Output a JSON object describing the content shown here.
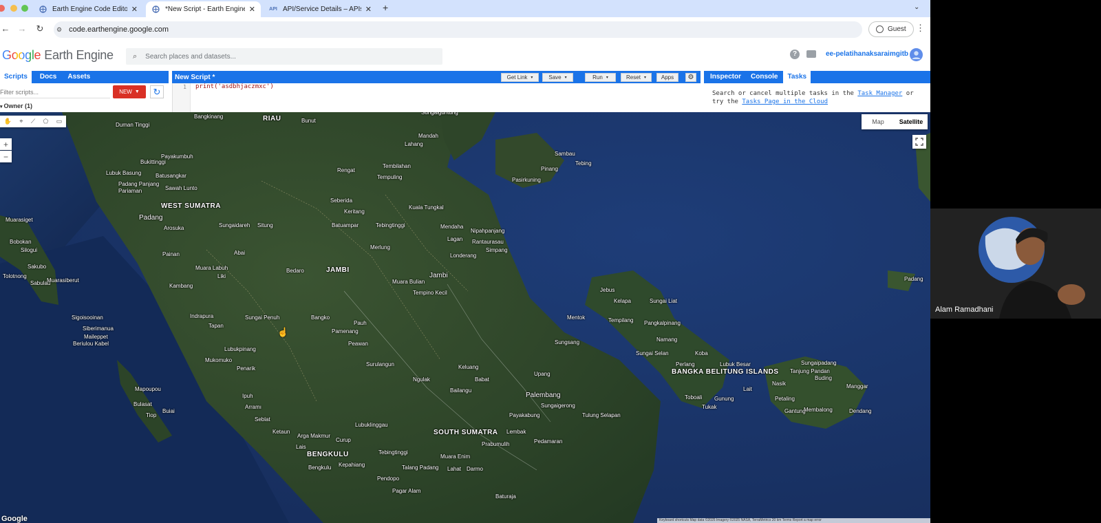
{
  "browser": {
    "tabs": [
      {
        "title": "Earth Engine Code Editor",
        "active": false
      },
      {
        "title": "*New Script - Earth Engine Co",
        "active": true
      },
      {
        "title": "API/Service Details – APIs & S",
        "active": false
      }
    ],
    "api_badge": "API",
    "new_tab": "+",
    "url": "code.earthengine.google.com",
    "guest_label": "Guest"
  },
  "ee": {
    "logo_google": "Google",
    "logo_product": "Earth Engine",
    "search_placeholder": "Search places and datasets...",
    "project": "ee-pelatihanaksaraimgitb"
  },
  "left_panel": {
    "tabs": [
      "Scripts",
      "Docs",
      "Assets"
    ],
    "filter_placeholder": "Filter scripts...",
    "new_button": "NEW",
    "owner_label": "Owner (1)"
  },
  "editor": {
    "title": "New Script *",
    "buttons": [
      "Get Link",
      "Save",
      "Run",
      "Reset",
      "Apps"
    ],
    "line_number": "1",
    "code": "print('asdbhjaczmxc')"
  },
  "right_panel": {
    "tabs": [
      "Inspector",
      "Console",
      "Tasks"
    ],
    "text_1": "Search or cancel multiple tasks in the ",
    "link_1": "Task Manager",
    "text_2": " or try the ",
    "link_2": "Tasks Page in the Cloud"
  },
  "map": {
    "type_buttons": [
      "Map",
      "Satellite"
    ],
    "active_type": "Satellite",
    "zoom_in": "+",
    "zoom_out": "−",
    "google_watermark": "Google",
    "attribution": "Keyboard shortcuts   Map data ©2025 Imagery ©2025 NASA, TerraMetrics   20 km   Terms   Report a map error",
    "labels": [
      "RIAU",
      "Duman Tinggi",
      "Bangkinang",
      "Bunut",
      "Mandah",
      "Sungaiguntung",
      "Lahang",
      "Payakumbuh",
      "Bukittinggi",
      "Lubuk Basung",
      "Batusangkar",
      "Padang Panjang",
      "Pariaman",
      "Sawah Lunto",
      "Rengat",
      "Tembilahan",
      "Tempuling",
      "Sambau",
      "Tebing",
      "Pinang",
      "Pasirkuning",
      "WEST SUMATRA",
      "Padang",
      "Arosuka",
      "Seberida",
      "Keritang",
      "Kuala Tungkal",
      "Muarasiget",
      "Sungaidareh",
      "Situng",
      "Batuampar",
      "Tebingtinggi",
      "Mendaha",
      "Nipahpanjang",
      "Rantaurasau",
      "Bobokan",
      "Silogui",
      "Sakubo",
      "Tolotnong",
      "Sabulau",
      "Muarasiberut",
      "Painan",
      "Abai",
      "Lagan",
      "Merlung",
      "Londerang",
      "Simpang",
      "Muara Labuh",
      "Liki",
      "Kambang",
      "JAMBI",
      "Bedaro",
      "Muara Bulian",
      "Jambi",
      "Tempino Kecil",
      "Jebus",
      "Kelapa",
      "Sungai Liat",
      "Mentok",
      "Tempilang",
      "Pangkalpinang",
      "Padang",
      "Indrapura",
      "Sungai Penuh",
      "Tapan",
      "Bangko",
      "Pauh",
      "Pamenang",
      "Sigoisooinan",
      "Siberimanua",
      "Maileppet",
      "Beriulou Kabel",
      "Lubukpinang",
      "Peawan",
      "Sungsang",
      "Namang",
      "Sungai Selan",
      "Koba",
      "Perlang",
      "Lubuk Besar",
      "Mukomuko",
      "Penarik",
      "Surulangun",
      "Keluang",
      "Ngulak",
      "Babat",
      "Upang",
      "BANGKA BELITUNG ISLANDS",
      "Sungaipadang",
      "Tanjung Pandan",
      "Buding",
      "Manggar",
      "Nasik",
      "Petaling",
      "Gantung",
      "Membalong",
      "Dendang",
      "Ipuh",
      "Bailangu",
      "Palembang",
      "Sungaigerong",
      "Toboali",
      "Tukak",
      "Gunung",
      "Lait",
      "Mapoupou",
      "Bulasat",
      "Tiop",
      "Buiai",
      "Arramı",
      "Payakabung",
      "Tulung Selapan",
      "Seblat",
      "SOUTH SUMATRA",
      "Lubuklinggau",
      "Lembak",
      "Ketaun",
      "Arga Makmur",
      "Curup",
      "Prabumulih",
      "Pedamaran",
      "BENGKULU",
      "Lais",
      "Tebingtinggi",
      "Muara Enim",
      "Bengkulu",
      "Kepahiang",
      "Talang Padang",
      "Lahat",
      "Darmo",
      "Pendopo",
      "Pagar Alam",
      "Baturaja"
    ]
  },
  "video": {
    "presenter_name": "Alam Ramadhani"
  },
  "colors": {
    "ee_blue": "#1a73e8",
    "new_button_red": "#d93025",
    "tabbar": "#d3e2fd"
  }
}
